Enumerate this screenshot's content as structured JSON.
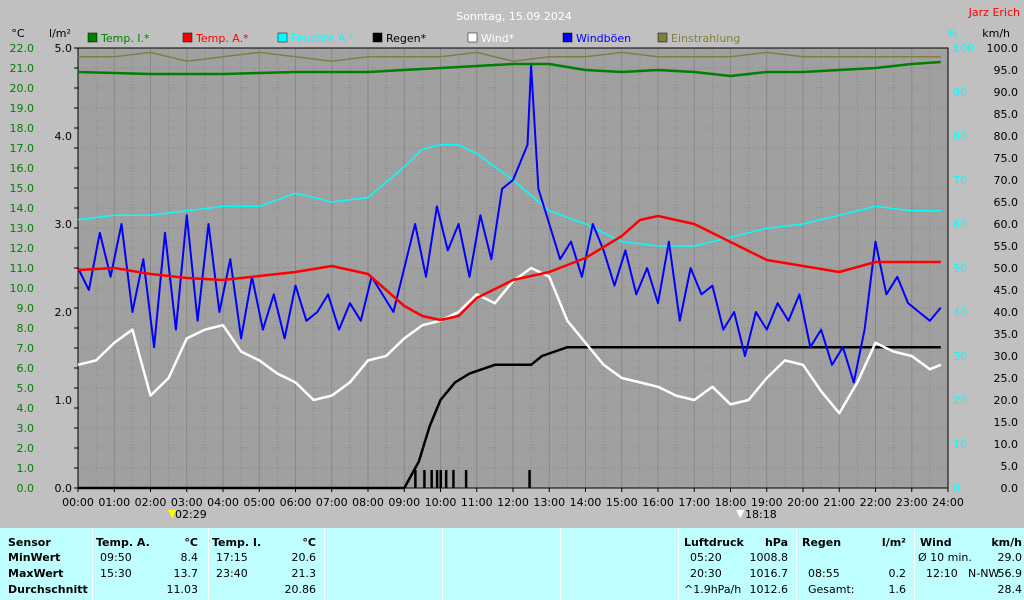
{
  "header": {
    "title": "Sonntag, 15.09.2024",
    "author": "Jarz Erich"
  },
  "axes": {
    "left_unit_temp": "°C",
    "left_unit_rain": "l/m²",
    "right_unit_pct": "%",
    "right_unit_wind": "km/h"
  },
  "legend": [
    {
      "label": "Temp. I.*",
      "color": "#007f00"
    },
    {
      "label": "Temp. A.*",
      "color": "#ff0000"
    },
    {
      "label": "Feuchte A.*",
      "color": "#00ffff"
    },
    {
      "label": "Regen*",
      "color": "#000000"
    },
    {
      "label": "Wind*",
      "color": "#ffffff"
    },
    {
      "label": "Windböen",
      "color": "#0000ff"
    },
    {
      "label": "Einstrahlung",
      "color": "#807f3f"
    }
  ],
  "markers": {
    "sunrise": "02:29",
    "sunset": "18:18"
  },
  "chart_data": {
    "type": "line",
    "title": "Sonntag, 15.09.2024",
    "x_ticks": [
      "00:00",
      "01:00",
      "02:00",
      "03:00",
      "04:00",
      "05:00",
      "06:00",
      "07:00",
      "08:00",
      "09:00",
      "10:00",
      "11:00",
      "12:00",
      "13:00",
      "14:00",
      "15:00",
      "16:00",
      "17:00",
      "18:00",
      "19:00",
      "20:00",
      "21:00",
      "22:00",
      "23:00",
      "24:00"
    ],
    "xlim_hours": [
      0,
      24
    ],
    "y_temp_ticks": [
      "22.0",
      "21.0",
      "20.0",
      "19.0",
      "18.0",
      "17.0",
      "16.0",
      "15.0",
      "14.0",
      "13.0",
      "12.0",
      "11.0",
      "10.0",
      "9.0",
      "8.0",
      "7.0",
      "6.0",
      "5.0",
      "4.0",
      "3.0",
      "2.0",
      "1.0",
      "0.0"
    ],
    "y_temp_lim": [
      0,
      22
    ],
    "y_rain_ticks": [
      "5.0",
      "4.0",
      "3.0",
      "2.0",
      "1.0",
      "0.0"
    ],
    "y_rain_lim": [
      0,
      5
    ],
    "y_pct_ticks": [
      "100",
      "90",
      "80",
      "70",
      "60",
      "50",
      "40",
      "30",
      "20",
      "10",
      "0"
    ],
    "y_pct_lim": [
      0,
      100
    ],
    "y_wind_ticks": [
      "100.0",
      "95.0",
      "90.0",
      "85.0",
      "80.0",
      "75.0",
      "70.0",
      "65.0",
      "60.0",
      "55.0",
      "50.0",
      "45.0",
      "40.0",
      "35.0",
      "30.0",
      "25.0",
      "20.0",
      "15.0",
      "10.0",
      "5.0",
      "0.0"
    ],
    "y_wind_lim": [
      0,
      100
    ],
    "grid": true,
    "series": [
      {
        "name": "Temp. I.*",
        "axis": "temp",
        "color": "#007f00",
        "x": [
          0,
          2,
          4,
          6,
          8,
          10,
          11,
          12,
          13,
          14,
          15,
          16,
          17,
          18,
          19,
          20,
          21,
          22,
          23,
          23.8
        ],
        "y": [
          20.8,
          20.7,
          20.7,
          20.8,
          20.8,
          21.0,
          21.1,
          21.2,
          21.2,
          20.9,
          20.8,
          20.9,
          20.8,
          20.6,
          20.8,
          20.8,
          20.9,
          21.0,
          21.2,
          21.3
        ]
      },
      {
        "name": "Temp. A.*",
        "axis": "temp",
        "color": "#ff0000",
        "x": [
          0,
          1,
          2,
          3,
          4,
          5,
          6,
          7,
          8,
          9,
          9.5,
          10,
          10.5,
          11,
          12,
          13,
          14,
          15,
          15.5,
          16,
          17,
          18,
          19,
          20,
          21,
          22,
          23,
          23.8
        ],
        "y": [
          10.9,
          11.0,
          10.7,
          10.5,
          10.4,
          10.6,
          10.8,
          11.1,
          10.7,
          9.1,
          8.6,
          8.4,
          8.6,
          9.5,
          10.4,
          10.8,
          11.5,
          12.6,
          13.4,
          13.6,
          13.2,
          12.3,
          11.4,
          11.1,
          10.8,
          11.3,
          11.3,
          11.3
        ]
      },
      {
        "name": "Feuchte A.*",
        "axis": "pct",
        "color": "#00ffff",
        "x": [
          0,
          1,
          2,
          3,
          4,
          5,
          6,
          7,
          8,
          9,
          9.5,
          10,
          10.5,
          11,
          12,
          13,
          14,
          15,
          16,
          17,
          18,
          19,
          20,
          21,
          22,
          23,
          23.8
        ],
        "y": [
          61,
          62,
          62,
          63,
          64,
          64,
          67,
          65,
          66,
          73,
          77,
          78,
          78,
          76,
          70,
          63,
          60,
          56,
          55,
          55,
          57,
          59,
          60,
          62,
          64,
          63,
          63
        ]
      },
      {
        "name": "Regen*",
        "axis": "rain",
        "color": "#000000",
        "x": [
          0,
          9,
          9.4,
          9.7,
          10,
          10.4,
          10.8,
          11.5,
          12,
          12.5,
          12.8,
          13.5,
          14,
          15,
          16,
          17,
          18,
          19,
          20,
          21,
          22,
          23,
          23.8
        ],
        "y": [
          0,
          0,
          0.3,
          0.7,
          1.0,
          1.2,
          1.3,
          1.4,
          1.4,
          1.4,
          1.5,
          1.6,
          1.6,
          1.6,
          1.6,
          1.6,
          1.6,
          1.6,
          1.6,
          1.6,
          1.6,
          1.6,
          1.6
        ]
      },
      {
        "name": "Wind*",
        "axis": "wind",
        "color": "#ffffff",
        "x": [
          0,
          0.5,
          1,
          1.5,
          2,
          2.5,
          3,
          3.5,
          4,
          4.5,
          5,
          5.5,
          6,
          6.5,
          7,
          7.5,
          8,
          8.5,
          9,
          9.5,
          10,
          10.5,
          11,
          11.5,
          12,
          12.5,
          13,
          13.5,
          14,
          14.5,
          15,
          15.5,
          16,
          16.5,
          17,
          17.5,
          18,
          18.5,
          19,
          19.5,
          20,
          20.5,
          21,
          21.5,
          22,
          22.5,
          23,
          23.5,
          23.8
        ],
        "y": [
          28,
          29,
          33,
          36,
          21,
          25,
          34,
          36,
          37,
          31,
          29,
          26,
          24,
          20,
          21,
          24,
          29,
          30,
          34,
          37,
          38,
          40,
          44,
          42,
          47,
          50,
          48,
          38,
          33,
          28,
          25,
          24,
          23,
          21,
          20,
          23,
          19,
          20,
          25,
          29,
          28,
          22,
          17,
          24,
          33,
          31,
          30,
          27,
          28
        ]
      },
      {
        "name": "Windböen",
        "axis": "wind",
        "color": "#0000ff",
        "x": [
          0,
          0.3,
          0.6,
          0.9,
          1.2,
          1.5,
          1.8,
          2.1,
          2.4,
          2.7,
          3.0,
          3.3,
          3.6,
          3.9,
          4.2,
          4.5,
          4.8,
          5.1,
          5.4,
          5.7,
          6.0,
          6.3,
          6.6,
          6.9,
          7.2,
          7.5,
          7.8,
          8.1,
          8.4,
          8.7,
          9.0,
          9.3,
          9.6,
          9.9,
          10.2,
          10.5,
          10.8,
          11.1,
          11.4,
          11.7,
          12.0,
          12.2,
          12.4,
          12.5,
          12.7,
          13.0,
          13.3,
          13.6,
          13.9,
          14.2,
          14.5,
          14.8,
          15.1,
          15.4,
          15.7,
          16.0,
          16.3,
          16.6,
          16.9,
          17.2,
          17.5,
          17.8,
          18.1,
          18.4,
          18.7,
          19.0,
          19.3,
          19.6,
          19.9,
          20.2,
          20.5,
          20.8,
          21.1,
          21.4,
          21.7,
          22.0,
          22.3,
          22.6,
          22.9,
          23.2,
          23.5,
          23.8
        ],
        "y": [
          50,
          45,
          58,
          48,
          60,
          40,
          52,
          32,
          58,
          36,
          62,
          38,
          60,
          40,
          52,
          34,
          48,
          36,
          44,
          34,
          46,
          38,
          40,
          44,
          36,
          42,
          38,
          48,
          44,
          40,
          50,
          60,
          48,
          64,
          54,
          60,
          48,
          62,
          52,
          68,
          70,
          74,
          78,
          96,
          68,
          60,
          52,
          56,
          48,
          60,
          54,
          46,
          54,
          44,
          50,
          42,
          56,
          38,
          50,
          44,
          46,
          36,
          40,
          30,
          40,
          36,
          42,
          38,
          44,
          32,
          36,
          28,
          32,
          24,
          36,
          56,
          44,
          48,
          42,
          40,
          38,
          41
        ]
      },
      {
        "name": "Einstrahlung",
        "axis": "pct",
        "color": "#807f3f",
        "x": [
          0,
          1,
          2,
          3,
          4,
          5,
          6,
          7,
          8,
          9,
          10,
          11,
          12,
          13,
          14,
          15,
          16,
          17,
          18,
          19,
          20,
          21,
          22,
          23,
          23.8
        ],
        "y": [
          98,
          98,
          99,
          97,
          98,
          99,
          98,
          97,
          98,
          98,
          98,
          99,
          97,
          98,
          98,
          99,
          98,
          98,
          98,
          99,
          98,
          98,
          98,
          98,
          98
        ]
      }
    ],
    "rain_bars_hours": [
      9.3,
      9.55,
      9.75,
      9.9,
      10.0,
      10.15,
      10.35,
      10.7,
      12.45
    ]
  },
  "stats_table": {
    "sensor_header": "Sensor",
    "row_labels": [
      "MinWert",
      "MaxWert",
      "Durchschnitt"
    ],
    "temp_a": {
      "header": "Temp. A.",
      "unit": "°C",
      "times": [
        "09:50",
        "15:30",
        ""
      ],
      "values": [
        "8.4",
        "13.7",
        "11.03"
      ]
    },
    "temp_i": {
      "header": "Temp. I.",
      "unit": "°C",
      "times": [
        "17:15",
        "23:40",
        ""
      ],
      "values": [
        "20.6",
        "21.3",
        "20.86"
      ]
    },
    "pressure": {
      "header": "Luftdruck",
      "unit": "hPa",
      "times": [
        "05:20",
        "20:30",
        "^1.9hPa/h"
      ],
      "values": [
        "1008.8",
        "1016.7",
        "1012.6"
      ]
    },
    "rain": {
      "header": "Regen",
      "unit": "l/m²",
      "times": [
        "",
        "08:55",
        "Gesamt:"
      ],
      "values": [
        "",
        "0.2",
        "1.6"
      ]
    },
    "wind": {
      "header": "Wind",
      "unit": "km/h",
      "times": [
        "Ø 10 min.",
        "12:10",
        ""
      ],
      "dirs": [
        "",
        "N-NW",
        ""
      ],
      "values": [
        "29.0",
        "56.9",
        "28.4"
      ]
    }
  }
}
